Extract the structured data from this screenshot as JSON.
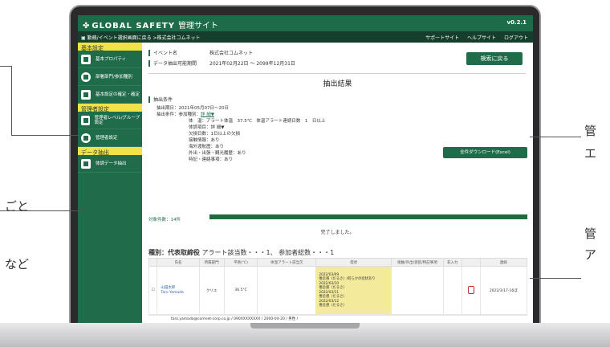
{
  "header": {
    "logo_mark": "✤",
    "logo_text": "GLOBAL SAFETY",
    "site_name": "管理サイト",
    "version": "v0.2.1"
  },
  "toolbar": {
    "breadcrumb": "▣ 勤務/イベント選択画面に戻る  >株式会社コムネット",
    "support": "サポートサイト",
    "help": "ヘルプサイト",
    "logout": "ログアウト"
  },
  "sidebar": {
    "section_basic": "基本設定",
    "items_basic": [
      "基本プロパティ",
      "部署部門/参加種別",
      "基本設定の確定・確定"
    ],
    "section_admin": "管理者設定",
    "items_admin": [
      "管理者レベル/グループ設定",
      "管理者設定"
    ],
    "section_extract": "データ抽出",
    "items_extract": [
      "体調データ抽出"
    ]
  },
  "main": {
    "event_label": "イベント名",
    "event_value": "株式会社コムネット",
    "period_label": "データ抽出可能期間",
    "period_value": "2021年02月22日 ～ 2099年12月31日",
    "back_button": "検索に戻る",
    "page_title": "抽出結果",
    "conditions_head": "抽出条件",
    "cond_date": "抽出期日：2021年05月07日～20日",
    "cond_type_prefix": "抽出条件：参加種別：",
    "cond_type_value": "詳 細▼",
    "cond_lines": [
      "体　温：アラート体温　37.5℃　体温アラート連続日数　1　日以上",
      "体調項目：詳 細▼",
      "欠損日数：1日以上の欠損",
      "接触情報：あり",
      "海外渡航歴：あり",
      "外出・出張・観光履歴：あり",
      "特記・連絡事項：あり"
    ],
    "download_button": "全件ダウンロード(Excel)",
    "count": "対象件数：14件",
    "progress": 1.0,
    "complete": "完了しました。",
    "type_line_key": "種別：代表取締役",
    "type_line_rest": "アラート該当数・・・1、 参加者総数・・・1"
  },
  "table": {
    "headers": [
      "",
      "氏名",
      "所属部門",
      "平熱(℃)",
      "体温アラート該当欠",
      "症状",
      "接触/外出/渡航/特記事項",
      "非入力",
      "",
      "連絡"
    ],
    "row": {
      "name": "山田太郎",
      "name_en": "Taro Yamada",
      "dept": "クリエ",
      "temp": "36.5°C",
      "log": [
        "2022/03/09",
        "倦怠感（だるさ）/何らかの症状あり",
        "2022/03/10",
        "倦怠感（だるさ）",
        "2022/03/11",
        "倦怠感（だるさ）",
        "2022/03/12",
        "倦怠感（だるさ）"
      ],
      "contact": "2022/3/17-16ぼ"
    },
    "footer": "taro.yamada@comnet-corp.co.jp / 090XXXXXXXX / 2000-04-20 / 男性 /"
  },
  "outside": {
    "right_1": "管",
    "right_2": "エ",
    "right_3": "管",
    "right_4": "ア",
    "left_1": "ごと",
    "left_2": "など"
  }
}
